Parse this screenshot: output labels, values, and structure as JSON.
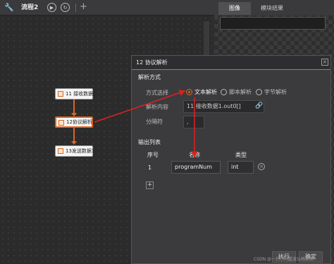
{
  "toolbar": {
    "wrench_icon": "wrench-icon",
    "flow_tab": "流程2",
    "run_icon": "play-icon",
    "loop_icon": "loop-icon",
    "add_tab": "+"
  },
  "right_panel": {
    "tabs": [
      {
        "label": "图像"
      },
      {
        "label": "模块结果"
      }
    ]
  },
  "flow": {
    "nodes": [
      {
        "label": "11 接收数据1"
      },
      {
        "label": "12协议解析1"
      },
      {
        "label": "13发送数据1"
      }
    ]
  },
  "dialog": {
    "title": "12 协议解析",
    "parse_section": "解析方式",
    "method_label": "方式选择",
    "methods": [
      "文本解析",
      "脚本解析",
      "字节解析"
    ],
    "selected_method": "文本解析",
    "content_label": "解析内容",
    "content_value": "11 接收数据1.out0[]",
    "separator_label": "分隔符",
    "separator_value": ",",
    "output_section": "输出列表",
    "columns": [
      "序号",
      "名称",
      "类型"
    ],
    "rows": [
      {
        "index": "1",
        "name": "programNum",
        "type": "int"
      }
    ],
    "add_label": "+",
    "execute_label": "执行",
    "confirm_label": "确定"
  },
  "watermark": "CSDN @一只小阿嘉波以梅斯佩",
  "colors": {
    "accent": "#e0651f",
    "annotation_red": "#e02020"
  }
}
